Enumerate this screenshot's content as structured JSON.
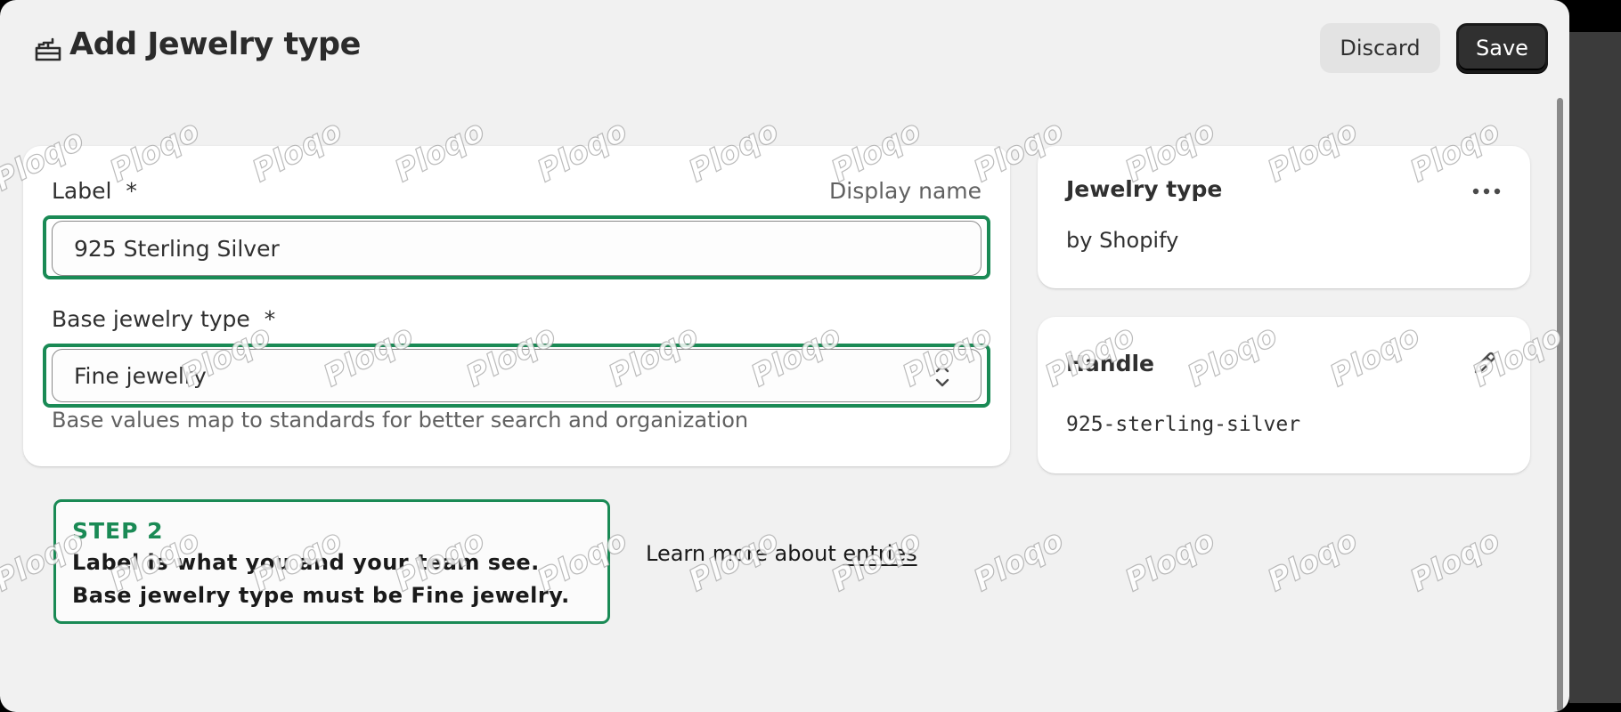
{
  "header": {
    "title": "Add Jewelry type",
    "icon": "metaobject-icon",
    "discard_label": "Discard",
    "save_label": "Save"
  },
  "form": {
    "label_field": {
      "label": "Label",
      "required_mark": "*",
      "aux": "Display name",
      "value": "925 Sterling Silver"
    },
    "base_type_field": {
      "label": "Base jewelry type",
      "required_mark": "*",
      "selected": "Fine jewelry",
      "help": "Base values map to standards for better search and organization"
    }
  },
  "sidebar": {
    "type_card": {
      "title": "Jewelry type",
      "subtitle": "by Shopify"
    },
    "handle_card": {
      "title": "Handle",
      "value": "925-sterling-silver"
    }
  },
  "step": {
    "title": "STEP 2",
    "line1": "Label is what you and your team see.",
    "line2": "Base jewelry type must be Fine jewelry."
  },
  "learn_more": {
    "prefix": "Learn more about ",
    "link": "entries"
  },
  "watermark": "Ploqo",
  "colors": {
    "highlight": "#1a8a55",
    "primary_button": "#303030",
    "background": "#f1f1f1"
  }
}
